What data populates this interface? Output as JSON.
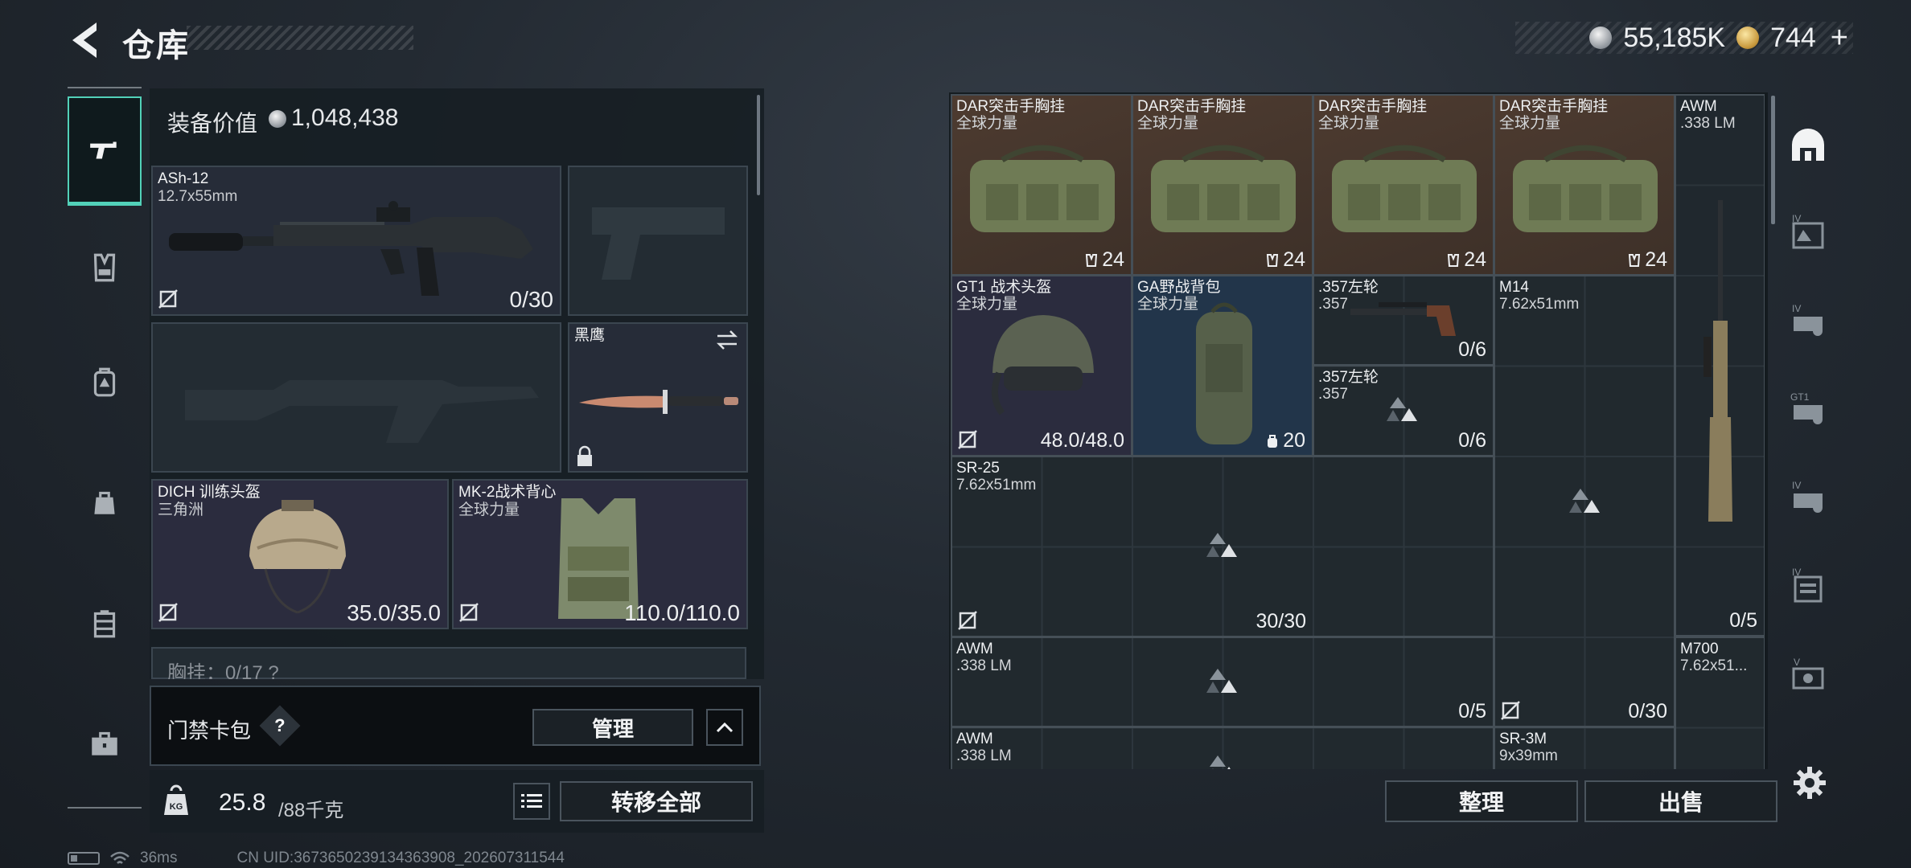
{
  "header": {
    "title": "仓库"
  },
  "currency": {
    "silver": "55,185K",
    "gold": "744",
    "plus": "+"
  },
  "side_nav": [
    {
      "name": "weapons",
      "icon": "gun-icon"
    },
    {
      "name": "armor",
      "icon": "chest-rig-icon"
    },
    {
      "name": "backpack",
      "icon": "backpack-icon"
    },
    {
      "name": "pouch",
      "icon": "pouch-icon"
    },
    {
      "name": "case",
      "icon": "case-icon"
    },
    {
      "name": "briefcase",
      "icon": "briefcase-icon"
    }
  ],
  "equip": {
    "value_label": "装备价值",
    "value": "1,048,438",
    "primary": {
      "name": "ASh-12",
      "caliber": "12.7x55mm",
      "ammo": "0/30"
    },
    "knife": {
      "name": "黑鹰"
    },
    "helmet": {
      "name": "DICH 训练头盔",
      "faction": "三角洲",
      "durability": "35.0/35.0"
    },
    "vest": {
      "name": "MK-2战术背心",
      "faction": "全球力量",
      "durability": "110.0/110.0"
    },
    "chest_peek": "胸挂：0/17  ?"
  },
  "keycard": {
    "label": "门禁卡包",
    "help": "?",
    "manage": "管理"
  },
  "weight": {
    "value": "25.8",
    "max": "/88千克",
    "transfer": "转移全部"
  },
  "status": {
    "ping": "36ms",
    "uid": "CN UID:3673650239134363908_202607311544"
  },
  "storage": {
    "items": [
      {
        "name": "DAR突击手胸挂",
        "sub": "全球力量",
        "count": "24",
        "kind": "bag"
      },
      {
        "name": "DAR突击手胸挂",
        "sub": "全球力量",
        "count": "24",
        "kind": "bag"
      },
      {
        "name": "DAR突击手胸挂",
        "sub": "全球力量",
        "count": "24",
        "kind": "bag"
      },
      {
        "name": "DAR突击手胸挂",
        "sub": "全球力量",
        "count": "24",
        "kind": "bag"
      },
      {
        "name": "AWM",
        "sub": ".338 LM",
        "count": "0/5"
      },
      {
        "name": "GT1 战术头盔",
        "sub": "全球力量",
        "count": "48.0/48.0"
      },
      {
        "name": "GA野战背包",
        "sub": "全球力量",
        "count": "20"
      },
      {
        "name": ".357左轮",
        "sub": ".357",
        "count": "0/6"
      },
      {
        "name": ".357左轮",
        "sub": ".357",
        "count": "0/6"
      },
      {
        "name": "M14",
        "sub": "7.62x51mm",
        "count": "0/30"
      },
      {
        "name": "SR-25",
        "sub": "7.62x51mm",
        "count": "30/30"
      },
      {
        "name": "AWM",
        "sub": ".338 LM",
        "count": "0/5"
      },
      {
        "name": "M700",
        "sub": "7.62x51..."
      },
      {
        "name": "AWM",
        "sub": ".338 LM"
      },
      {
        "name": "SR-3M",
        "sub": "9x39mm"
      }
    ],
    "tidy": "整理",
    "sell": "出售"
  },
  "right_tabs": [
    {
      "name": "storage-main",
      "icon": "storage-icon",
      "badge": ""
    },
    {
      "name": "ext-1",
      "icon": "extension-icon",
      "badge": "IV"
    },
    {
      "name": "ext-2",
      "icon": "extension-icon",
      "badge": "IV"
    },
    {
      "name": "ext-3",
      "icon": "extension-icon",
      "badge": "GT1"
    },
    {
      "name": "ext-4",
      "icon": "extension-icon",
      "badge": "IV"
    },
    {
      "name": "ext-5",
      "icon": "extension-icon",
      "badge": "IV"
    },
    {
      "name": "ext-6",
      "icon": "extension-icon",
      "badge": "V"
    }
  ],
  "colors": {
    "accent": "#52d1b9",
    "bag_bg": "#4d3b30",
    "gear_bg": "#2b2c3e",
    "backpack_bg": "#22354a"
  }
}
